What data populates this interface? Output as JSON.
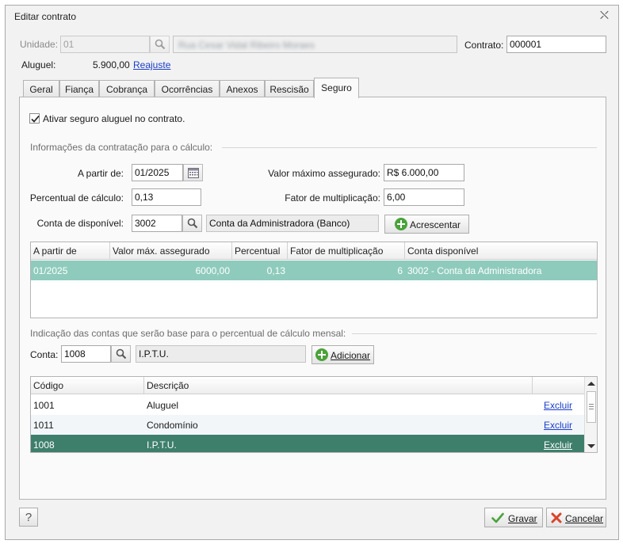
{
  "window": {
    "title": "Editar contrato",
    "close_glyph": "⛌"
  },
  "header": {
    "unidade_label": "Unidade:",
    "unidade_value": "01",
    "unidade_desc_blurred": "Rua Cesar Vidal Ribeiro Moraes",
    "contrato_label": "Contrato:",
    "contrato_value": "000001",
    "aluguel_label": "Aluguel:",
    "aluguel_value": "5.900,00",
    "reajuste_link": "Reajuste"
  },
  "tabs": [
    {
      "label": "Geral"
    },
    {
      "label": "Fiança"
    },
    {
      "label": "Cobrança"
    },
    {
      "label": "Ocorrências"
    },
    {
      "label": "Anexos"
    },
    {
      "label": "Rescisão"
    },
    {
      "label": "Seguro",
      "active": true
    }
  ],
  "seguro": {
    "ativar_label": "Ativar seguro aluguel no contrato.",
    "ativar_checked": true,
    "section1_title": "Informações da contratação para o cálculo:",
    "a_partir_label": "A partir de:",
    "a_partir_value": "01/2025",
    "valor_max_label": "Valor máximo assegurado:",
    "valor_max_value": "R$ 6.000,00",
    "percentual_label": "Percentual de cálculo:",
    "percentual_value": "0,13",
    "fator_label": "Fator de multiplicação:",
    "fator_value": "6,00",
    "conta_disp_label": "Conta de disponível:",
    "conta_disp_code": "3002",
    "conta_disp_desc": "Conta da Administradora (Banco)",
    "acrescentar_label": "Acrescentar",
    "grid1": {
      "columns": [
        "A partir de",
        "Valor máx. assegurado",
        "Percentual",
        "Fator de multiplicação",
        "Conta disponível"
      ],
      "rows": [
        {
          "a_partir": "01/2025",
          "valor_max": "6000,00",
          "percentual": "0,13",
          "fator": "6",
          "conta": "3002 - Conta da Administradora"
        }
      ]
    },
    "section2_title": "Indicação das contas que serão base para o percentual de cálculo mensal:",
    "conta_label": "Conta:",
    "conta_code": "1008",
    "conta_desc": "I.P.T.U.",
    "adicionar_label": "Adicionar",
    "grid2": {
      "columns": [
        "Código",
        "Descrição",
        ""
      ],
      "rows": [
        {
          "codigo": "1001",
          "descricao": "Aluguel",
          "action": "Excluir"
        },
        {
          "codigo": "1011",
          "descricao": "Condomínio",
          "action": "Excluir"
        },
        {
          "codigo": "1008",
          "descricao": "I.P.T.U.",
          "action": "Excluir"
        }
      ]
    }
  },
  "footer": {
    "help_label": "?",
    "gravar_label": "Gravar",
    "cancelar_label": "Cancelar"
  },
  "colors": {
    "selected_row_light": "#8fcbbc",
    "selected_row_dark": "#3e7f6b",
    "link": "#1a3dc8",
    "add_icon": "#4aa23a",
    "cancel_icon": "#d9442a",
    "save_icon": "#4aa23a"
  },
  "icons": [
    "search-icon",
    "calendar-icon",
    "plus-circle-icon",
    "check-icon",
    "cancel-x-icon",
    "help-icon",
    "scroll-up-icon",
    "scroll-down-icon"
  ]
}
